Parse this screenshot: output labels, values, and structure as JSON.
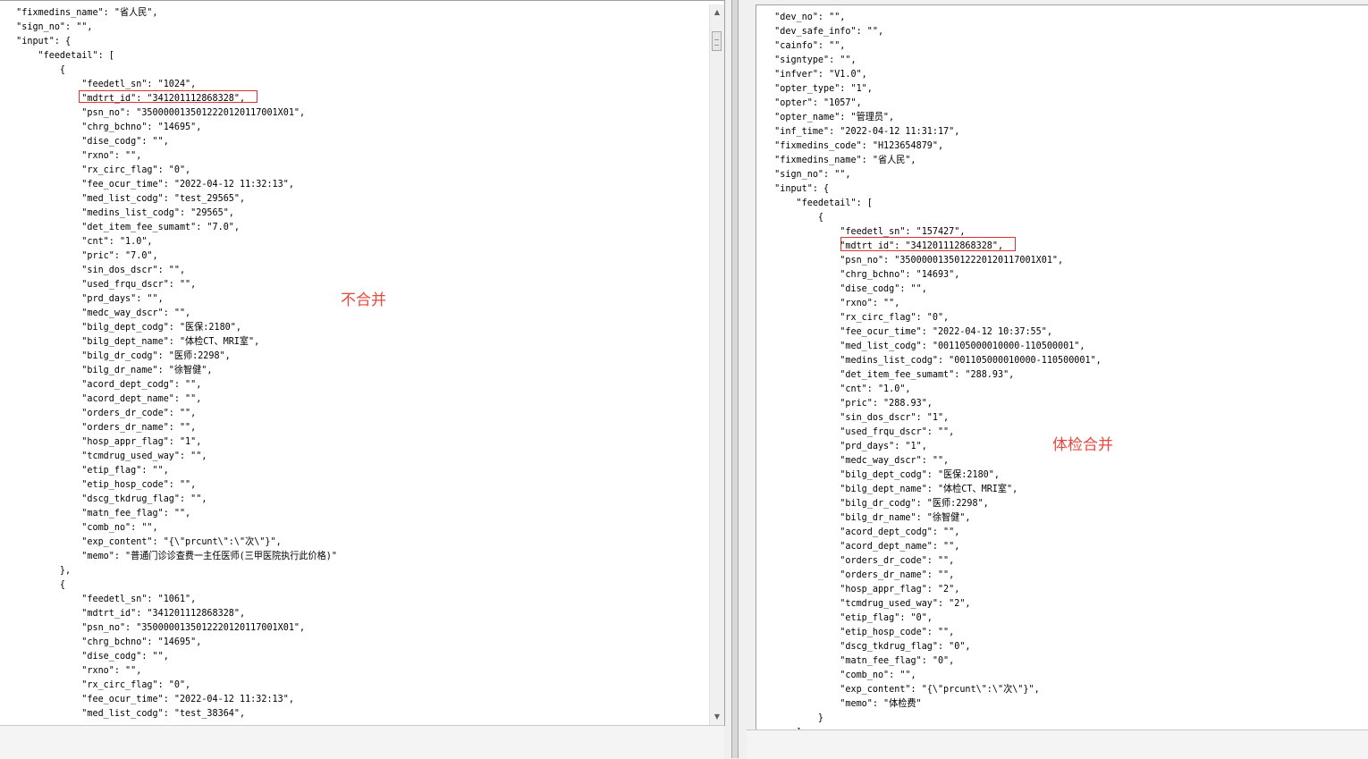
{
  "left_pane": {
    "lines": [
      {
        "t": "  \"fixmedins_name\": \"省人民\","
      },
      {
        "t": "  \"sign_no\": \"\","
      },
      {
        "t": "  \"input\": {"
      },
      {
        "t": "      \"feedetail\": ["
      },
      {
        "t": "          {"
      },
      {
        "t": "              \"feedetl_sn\": \"1024\","
      },
      {
        "t": "              \"mdtrt_id\": \"341201112868328\","
      },
      {
        "t": "              \"psn_no\": \"35000001350122201201170​01X01\","
      },
      {
        "t": "              \"chrg_bchno\": \"14695\","
      },
      {
        "t": "              \"dise_codg\": \"\","
      },
      {
        "t": "              \"rxno\": \"\","
      },
      {
        "t": "              \"rx_circ_flag\": \"0\","
      },
      {
        "t": "              \"fee_ocur_time\": \"2022-04-12 11:32:13\","
      },
      {
        "t": "              \"med_list_codg\": \"test_29565\","
      },
      {
        "t": "              \"medins_list_codg\": \"29565\","
      },
      {
        "t": "              \"det_item_fee_sumamt\": \"7.0\","
      },
      {
        "t": "              \"cnt\": \"1.0\","
      },
      {
        "t": "              \"pric\": \"7.0\","
      },
      {
        "t": "              \"sin_dos_dscr\": \"\","
      },
      {
        "t": "              \"used_frqu_dscr\": \"\","
      },
      {
        "t": "              \"prd_days\": \"\","
      },
      {
        "t": "              \"medc_way_dscr\": \"\","
      },
      {
        "t": "              \"bilg_dept_codg\": \"医保:2180\","
      },
      {
        "t": "              \"bilg_dept_name\": \"体检CT、MRI室\","
      },
      {
        "t": "              \"bilg_dr_codg\": \"医师:2298\","
      },
      {
        "t": "              \"bilg_dr_name\": \"徐智健\","
      },
      {
        "t": "              \"acord_dept_codg\": \"\","
      },
      {
        "t": "              \"acord_dept_name\": \"\","
      },
      {
        "t": "              \"orders_dr_code\": \"\","
      },
      {
        "t": "              \"orders_dr_name\": \"\","
      },
      {
        "t": "              \"hosp_appr_flag\": \"1\","
      },
      {
        "t": "              \"tcmdrug_used_way\": \"\","
      },
      {
        "t": "              \"etip_flag\": \"\","
      },
      {
        "t": "              \"etip_hosp_code\": \"\","
      },
      {
        "t": "              \"dscg_tkdrug_flag\": \"\","
      },
      {
        "t": "              \"matn_fee_flag\": \"\","
      },
      {
        "t": "              \"comb_no\": \"\","
      },
      {
        "t": "              \"exp_content\": \"{\\\"prcunt\\\":\\\"次\\\"}\","
      },
      {
        "t": "              \"memo\": \"普通门诊诊查费一主任医师(三甲医院执行此价格)\""
      },
      {
        "t": "          },"
      },
      {
        "t": "          {"
      },
      {
        "t": "              \"feedetl_sn\": \"1061\","
      },
      {
        "t": "              \"mdtrt_id\": \"341201112868328\","
      },
      {
        "t": "              \"psn_no\": \"35000001350122201201170​01X01\","
      },
      {
        "t": "              \"chrg_bchno\": \"14695\","
      },
      {
        "t": "              \"dise_codg\": \"\","
      },
      {
        "t": "              \"rxno\": \"\","
      },
      {
        "t": "              \"rx_circ_flag\": \"0\","
      },
      {
        "t": "              \"fee_ocur_time\": \"2022-04-12 11:32:13\","
      },
      {
        "t": "              \"med_list_codg\": \"test_38364\","
      }
    ],
    "annotation": "不合并"
  },
  "right_pane": {
    "lines": [
      {
        "t": "  \"dev_no\": \"\","
      },
      {
        "t": "  \"dev_safe_info\": \"\","
      },
      {
        "t": "  \"cainfo\": \"\","
      },
      {
        "t": "  \"signtype\": \"\","
      },
      {
        "t": "  \"infver\": \"V1.0\","
      },
      {
        "t": "  \"opter_type\": \"1\","
      },
      {
        "t": "  \"opter\": \"1057\","
      },
      {
        "t": "  \"opter_name\": \"管理员\","
      },
      {
        "t": "  \"inf_time\": \"2022-04-12 11:31:17\","
      },
      {
        "t": "  \"fixmedins_code\": \"H123654879\","
      },
      {
        "t": "  \"fixmedins_name\": \"省人民\","
      },
      {
        "t": "  \"sign_no\": \"\","
      },
      {
        "t": "  \"input\": {"
      },
      {
        "t": "      \"feedetail\": ["
      },
      {
        "t": "          {"
      },
      {
        "t": "              \"feedetl_sn\": \"157427\","
      },
      {
        "t": "              \"mdtrt_id\": \"341201112868328\","
      },
      {
        "t": "              \"psn_no\": \"35000001350122201201170​01X01\","
      },
      {
        "t": "              \"chrg_bchno\": \"14693\","
      },
      {
        "t": "              \"dise_codg\": \"\","
      },
      {
        "t": "              \"rxno\": \"\","
      },
      {
        "t": "              \"rx_circ_flag\": \"0\","
      },
      {
        "t": "              \"fee_ocur_time\": \"2022-04-12 10:37:55\","
      },
      {
        "t": "              \"med_list_codg\": \"001105000010000-110500001\","
      },
      {
        "t": "              \"medins_list_codg\": \"001105000010000-110500001\","
      },
      {
        "t": "              \"det_item_fee_sumamt\": \"288.93\","
      },
      {
        "t": "              \"cnt\": \"1.0\","
      },
      {
        "t": "              \"pric\": \"288.93\","
      },
      {
        "t": "              \"sin_dos_dscr\": \"1\","
      },
      {
        "t": "              \"used_frqu_dscr\": \"\","
      },
      {
        "t": "              \"prd_days\": \"1\","
      },
      {
        "t": "              \"medc_way_dscr\": \"\","
      },
      {
        "t": "              \"bilg_dept_codg\": \"医保:2180\","
      },
      {
        "t": "              \"bilg_dept_name\": \"体检CT、MRI室\","
      },
      {
        "t": "              \"bilg_dr_codg\": \"医师:2298\","
      },
      {
        "t": "              \"bilg_dr_name\": \"徐智健\","
      },
      {
        "t": "              \"acord_dept_codg\": \"\","
      },
      {
        "t": "              \"acord_dept_name\": \"\","
      },
      {
        "t": "              \"orders_dr_code\": \"\","
      },
      {
        "t": "              \"orders_dr_name\": \"\","
      },
      {
        "t": "              \"hosp_appr_flag\": \"2\","
      },
      {
        "t": "              \"tcmdrug_used_way\": \"2\","
      },
      {
        "t": "              \"etip_flag\": \"0\","
      },
      {
        "t": "              \"etip_hosp_code\": \"\","
      },
      {
        "t": "              \"dscg_tkdrug_flag\": \"0\","
      },
      {
        "t": "              \"matn_fee_flag\": \"0\","
      },
      {
        "t": "              \"comb_no\": \"\","
      },
      {
        "t": "              \"exp_content\": \"{\\\"prcunt\\\":\\\"次\\\"}\","
      },
      {
        "t": "              \"memo\": \"体检费\""
      },
      {
        "t": "          }"
      },
      {
        "t": "      ],"
      }
    ],
    "annotation": "体检合并"
  },
  "scrollbar": {
    "up_glyph": "▲",
    "down_glyph": "▼"
  }
}
